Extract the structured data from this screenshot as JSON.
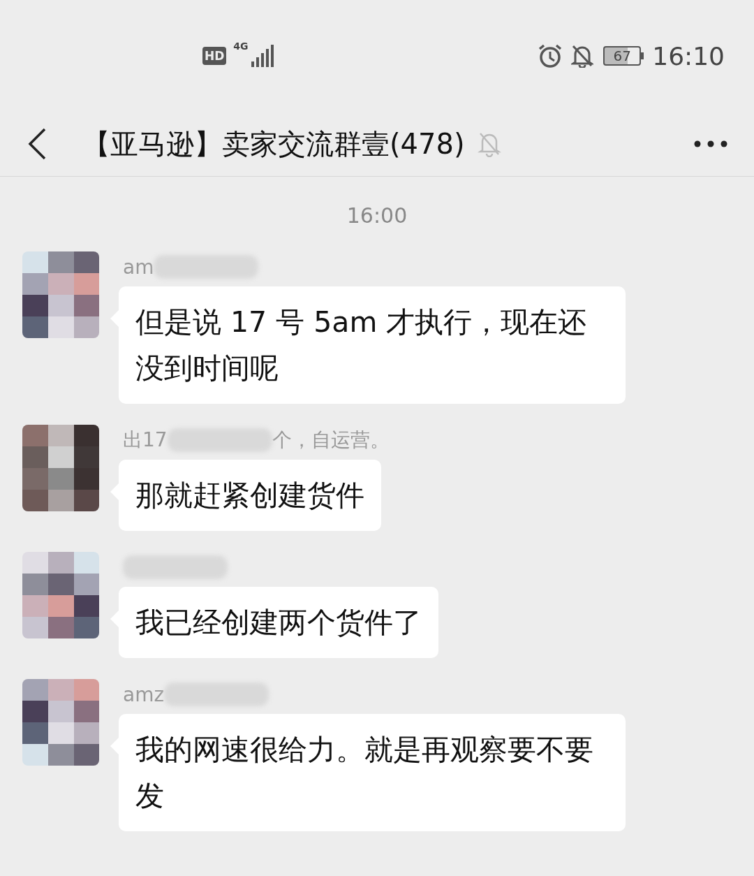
{
  "status_bar": {
    "hd": "HD",
    "network": "4G",
    "battery": "67",
    "time": "16:10"
  },
  "header": {
    "title": "【亚马逊】卖家交流群壹(478)",
    "muted": true
  },
  "timestamp": "16:00",
  "messages": [
    {
      "name": [
        {
          "kind": "text",
          "text": "am"
        },
        {
          "kind": "blur"
        }
      ],
      "text": "但是说 17 号 5am 才执行，现在还没到时间呢"
    },
    {
      "name": [
        {
          "kind": "text",
          "text": "出17"
        },
        {
          "kind": "blur"
        },
        {
          "kind": "text",
          "text": "个，自运营。"
        }
      ],
      "text": "那就赶紧创建货件"
    },
    {
      "name": [
        {
          "kind": "blur"
        }
      ],
      "text": "我已经创建两个货件了"
    },
    {
      "name": [
        {
          "kind": "text",
          "text": "amz"
        },
        {
          "kind": "blur"
        }
      ],
      "text": "我的网速很给力。就是再观察要不要发"
    }
  ]
}
